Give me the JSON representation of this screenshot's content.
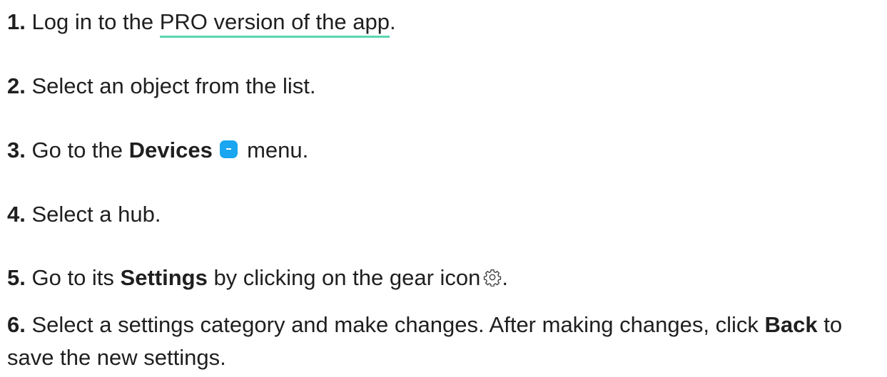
{
  "steps": [
    {
      "num": "1.",
      "pre": "Log in to the ",
      "link": "PRO version of the app",
      "post": "."
    },
    {
      "num": "2.",
      "text": "Select an object from the list."
    },
    {
      "num": "3.",
      "pre": "Go to the ",
      "bold": "Devices",
      "post": " menu.",
      "icon": "devices-icon"
    },
    {
      "num": "4.",
      "text": "Select a hub."
    },
    {
      "num": "5.",
      "pre": "Go to its ",
      "bold": "Settings",
      "mid": " by clicking on the gear icon",
      "post": ".",
      "icon": "gear-icon"
    },
    {
      "num": "6.",
      "pre": "Select a settings category and make changes. After making changes, click ",
      "bold": "Back",
      "post": " to save the new settings."
    }
  ],
  "colors": {
    "text": "#1f1f1f",
    "link_underline": "#5ad6b0",
    "devices_icon": "#1aa6f0",
    "gear_icon": "#444444"
  }
}
